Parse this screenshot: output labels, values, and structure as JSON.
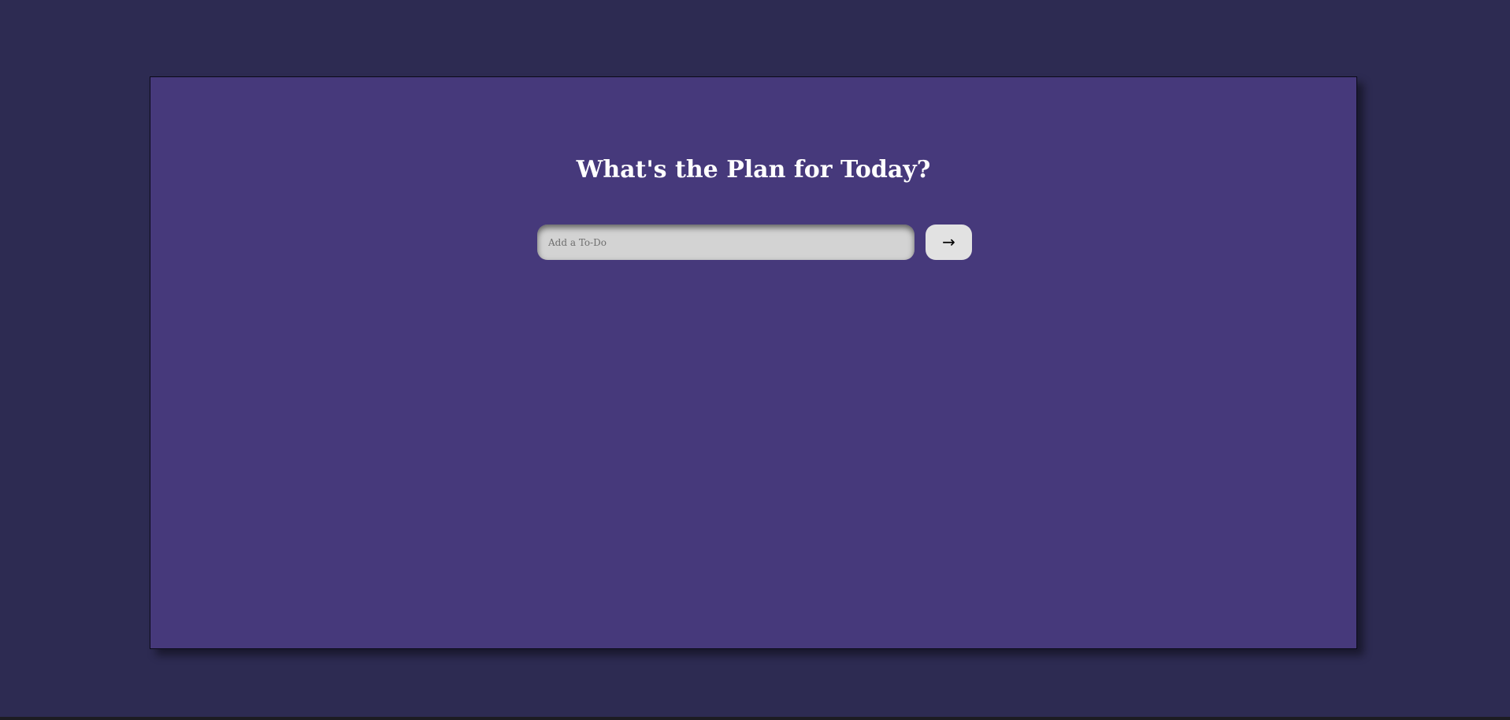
{
  "app": {
    "title": "What's the Plan for Today?"
  },
  "todo_form": {
    "input_value": "",
    "input_placeholder": "Add a To-Do",
    "submit_label": "→",
    "submit_icon": "arrow-right-icon"
  },
  "colors": {
    "background": "#2d2b52",
    "card": "#46397b",
    "title_text": "#ffffff",
    "input_bg": "#d3d3d3",
    "button_bg": "#e2e2e2"
  }
}
